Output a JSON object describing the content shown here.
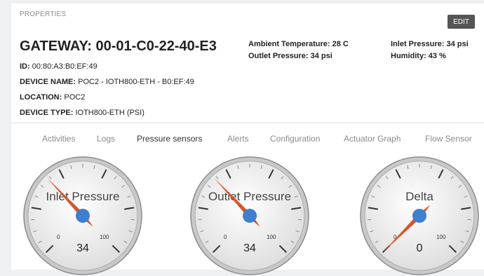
{
  "properties": {
    "label": "PROPERTIES",
    "edit_label": "EDIT"
  },
  "gateway": {
    "title": "GATEWAY: 00-01-C0-22-40-E3",
    "id_label": "ID:",
    "id_value": "00:80:A3:B0:EF:49",
    "device_name_label": "DEVICE NAME:",
    "device_name_value": "POC2 - IOTH800-ETH - B0:EF:49",
    "location_label": "LOCATION:",
    "location_value": "POC2",
    "device_type_label": "DEVICE TYPE:",
    "device_type_value": "IOTH800-ETH (PSI)"
  },
  "stats": {
    "ambient_temperature": "Ambient Temperature: 28 C",
    "outlet_pressure": "Outlet Pressure: 34 psi",
    "inlet_pressure": "Inlet Pressure: 34 psi",
    "humidity": "Humidity: 43 %"
  },
  "tabs": [
    {
      "label": "Activities",
      "active": false
    },
    {
      "label": "Logs",
      "active": false
    },
    {
      "label": "Pressure sensors",
      "active": true
    },
    {
      "label": "Alerts",
      "active": false
    },
    {
      "label": "Configuration",
      "active": false
    },
    {
      "label": "Actuator Graph",
      "active": false
    },
    {
      "label": "Flow Sensor",
      "active": false
    }
  ],
  "gauges": [
    {
      "label": "Inlet Pressure",
      "value": 34,
      "value_text": "34",
      "min_text": "0",
      "max_text": "100"
    },
    {
      "label": "Outlet Pressure",
      "value": 34,
      "value_text": "34",
      "min_text": "0",
      "max_text": "100"
    },
    {
      "label": "Delta",
      "value": 0,
      "value_text": "0",
      "min_text": "0",
      "max_text": "100"
    }
  ],
  "colors": {
    "needle": "#d8532b",
    "hub": "#3e7fcf",
    "bezel": "#8d8d8d",
    "edit_button": "#555555"
  }
}
